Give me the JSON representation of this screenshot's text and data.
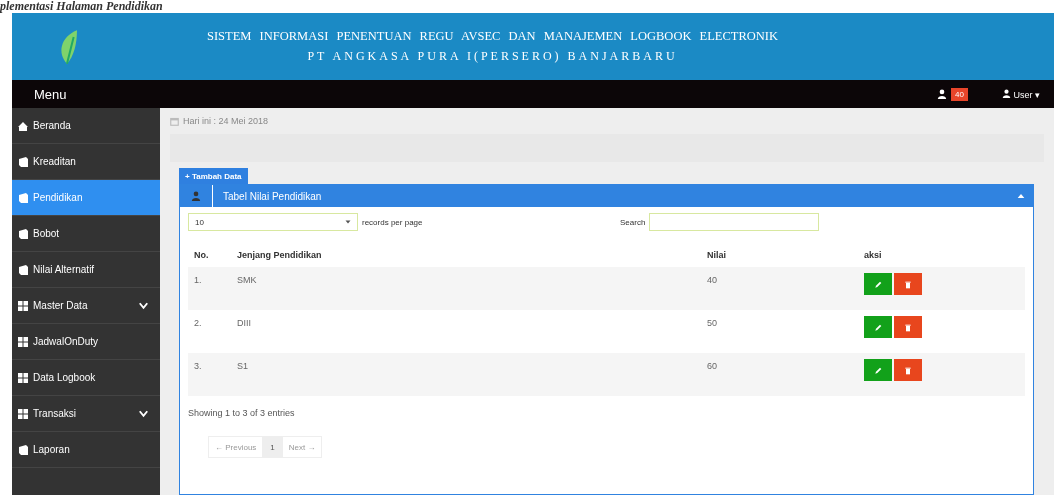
{
  "caption": "plementasi Halaman Pendidikan",
  "header": {
    "title": "SISTEM INFORMASI PENENTUAN REGU AVSEC DAN MANAJEMEN LOGBOOK ELECTRONIK",
    "subtitle": "PT ANGKASA PURA I(PERSERO) BANJARBARU"
  },
  "navbar": {
    "menu_label": "Menu",
    "badge": "40",
    "user": "User ▾"
  },
  "sidebar": {
    "items": [
      {
        "label": "Beranda",
        "kind": "home",
        "selected": false,
        "expandable": false
      },
      {
        "label": "Kreaditan",
        "kind": "book",
        "selected": false,
        "expandable": false
      },
      {
        "label": "Pendidikan",
        "kind": "book",
        "selected": true,
        "expandable": false
      },
      {
        "label": "Bobot",
        "kind": "book",
        "selected": false,
        "expandable": false
      },
      {
        "label": "Nilai Alternatif",
        "kind": "book",
        "selected": false,
        "expandable": false
      },
      {
        "label": "Master Data",
        "kind": "grid",
        "selected": false,
        "expandable": true
      },
      {
        "label": "JadwalOnDuty",
        "kind": "grid",
        "selected": false,
        "expandable": false
      },
      {
        "label": "Data Logbook",
        "kind": "grid",
        "selected": false,
        "expandable": false
      },
      {
        "label": "Transaksi",
        "kind": "grid",
        "selected": false,
        "expandable": true
      },
      {
        "label": "Laporan",
        "kind": "book",
        "selected": false,
        "expandable": false
      }
    ]
  },
  "date_line": "Hari ini : 24 Mei 2018",
  "add_button": "+ Tambah Data",
  "panel": {
    "title": "Tabel Nilai Pendidikan",
    "page_size": "10",
    "page_size_label": "records per page",
    "search_label": "Search",
    "columns": [
      "No.",
      "Jenjang Pendidikan",
      "Nilai",
      "aksi"
    ],
    "rows": [
      {
        "no": "1.",
        "level": "SMK",
        "score": "40"
      },
      {
        "no": "2.",
        "level": "DIII",
        "score": "50"
      },
      {
        "no": "3.",
        "level": "S1",
        "score": "60"
      }
    ],
    "info": "Showing 1 to 3 of 3 entries",
    "pagination": [
      {
        "label": "← Previous",
        "selected": false
      },
      {
        "label": "1",
        "selected": true
      },
      {
        "label": "Next →",
        "selected": false
      }
    ]
  }
}
